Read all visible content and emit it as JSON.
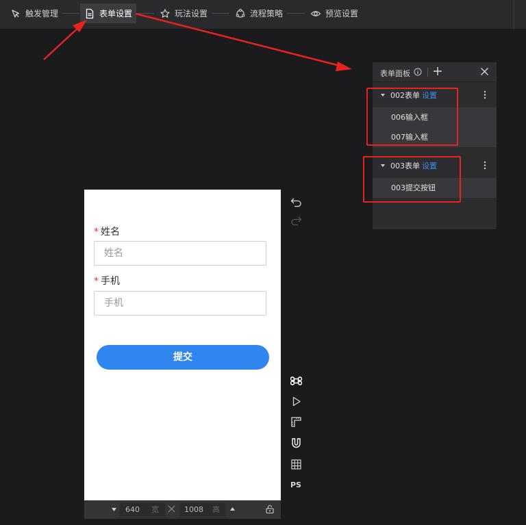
{
  "topbar": {
    "steps": [
      {
        "label": "触发管理",
        "icon": "cursor-click-icon"
      },
      {
        "label": "表单设置",
        "icon": "document-icon",
        "active": true
      },
      {
        "label": "玩法设置",
        "icon": "star-icon"
      },
      {
        "label": "流程策略",
        "icon": "flow-icon"
      },
      {
        "label": "预览设置",
        "icon": "eye-icon"
      }
    ]
  },
  "form_panel": {
    "title": "表单面板",
    "groups": [
      {
        "name": "002表单",
        "settings_label": "设置",
        "items": [
          "006输入框",
          "007输入框"
        ]
      },
      {
        "name": "003表单",
        "settings_label": "设置",
        "items": [
          "003提交按钮"
        ]
      }
    ]
  },
  "canvas_form": {
    "fields": [
      {
        "label": "姓名",
        "required_mark": "*",
        "placeholder": "姓名"
      },
      {
        "label": "手机",
        "required_mark": "*",
        "placeholder": "手机"
      }
    ],
    "submit_label": "提交"
  },
  "size_bar": {
    "width_value": "640",
    "width_unit": "宽",
    "height_value": "1008",
    "height_unit": "高"
  },
  "tools": {
    "ps_label": "PS"
  },
  "colors": {
    "accent": "#2f86ee",
    "annotation": "#e8231f",
    "link": "#3d8ef0"
  }
}
